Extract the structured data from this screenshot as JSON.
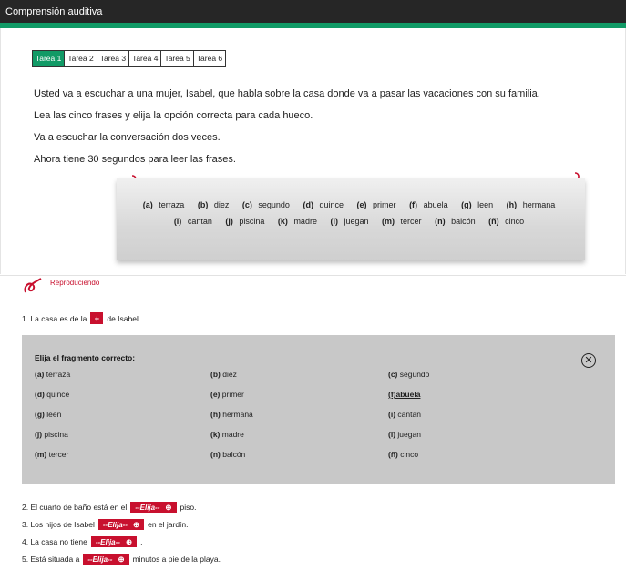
{
  "app": {
    "title": "Comprensión auditiva"
  },
  "tabs": [
    "Tarea 1",
    "Tarea 2",
    "Tarea 3",
    "Tarea 4",
    "Tarea 5",
    "Tarea 6"
  ],
  "active_tab": "Tarea 1",
  "instructions": [
    "Usted va a escuchar a una mujer, Isabel, que habla sobre la casa donde va a pasar las vacaciones con su familia.",
    "Lea las cinco frases y elija la opción correcta para cada hueco.",
    "Va a escuchar la conversación dos veces.",
    "Ahora tiene 30 segundos para leer las frases."
  ],
  "options": [
    {
      "letter": "(a)",
      "word": "terraza"
    },
    {
      "letter": "(b)",
      "word": "diez"
    },
    {
      "letter": "(c)",
      "word": "segundo"
    },
    {
      "letter": "(d)",
      "word": "quince"
    },
    {
      "letter": "(e)",
      "word": "primer"
    },
    {
      "letter": "(f)",
      "word": "abuela"
    },
    {
      "letter": "(g)",
      "word": "leen"
    },
    {
      "letter": "(h)",
      "word": "hermana"
    },
    {
      "letter": "(i)",
      "word": "cantan"
    },
    {
      "letter": "(j)",
      "word": "piscina"
    },
    {
      "letter": "(k)",
      "word": "madre"
    },
    {
      "letter": "(l)",
      "word": "juegan"
    },
    {
      "letter": "(m)",
      "word": "tercer"
    },
    {
      "letter": "(n)",
      "word": "balcón"
    },
    {
      "letter": "(ñ)",
      "word": "cinco"
    }
  ],
  "player": {
    "status": "Reproduciendo"
  },
  "questions": [
    {
      "before": "1. La casa es de la",
      "select": "+",
      "after": "de Isabel."
    },
    {
      "before": "2. El cuarto de baño está en el",
      "select": "--Elija--",
      "after": "piso."
    },
    {
      "before": "3. Los hijos de Isabel",
      "select": "--Elija--",
      "after": "en el jardín."
    },
    {
      "before": "4. La casa no tiene",
      "select": "--Elija--",
      "after": "."
    },
    {
      "before": "5. Está situada a",
      "select": "--Elija--",
      "after": "minutos a pie de la playa."
    }
  ],
  "chooser": {
    "title": "Elija el fragmento correcto:",
    "close_glyph": "✕",
    "selected": "(f) abuela"
  },
  "colors": {
    "accent_green": "#119a66",
    "accent_red": "#c8102e",
    "topbar": "#262626",
    "panel_gray": "#c8c8c8"
  },
  "icons": [
    "paperclip-icon",
    "audio-playing-icon",
    "close-icon",
    "plus-icon"
  ]
}
